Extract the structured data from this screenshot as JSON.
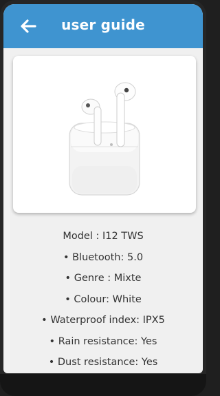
{
  "appbar": {
    "title": "user guide",
    "back_icon": "arrow-left-icon"
  },
  "product_image": {
    "icon": "earbuds-product-image"
  },
  "specs": [
    "Model : I12 TWS",
    "• Bluetooth: 5.0",
    "• Genre : Mixte",
    "• Colour: White",
    "• Waterproof index: IPX5",
    "• Rain resistance: Yes",
    "• Dust resistance: Yes"
  ],
  "colors": {
    "appbar": "#3f94d0",
    "background": "#f0f0f0",
    "text": "#333333"
  }
}
